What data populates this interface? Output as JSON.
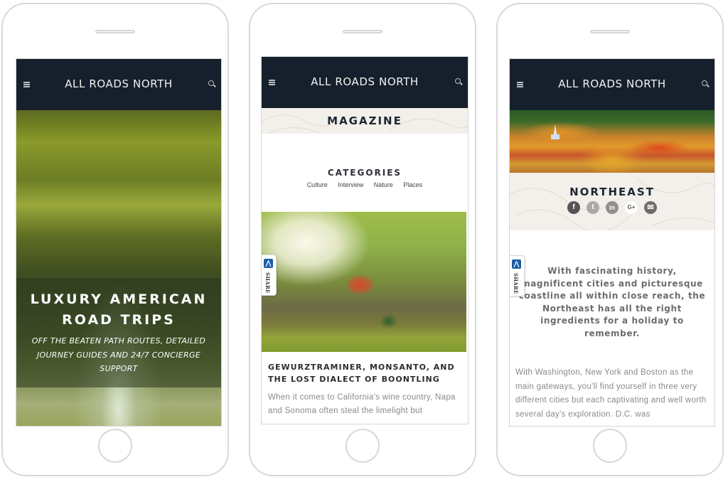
{
  "site": {
    "brand": "ALL ROADS NORTH"
  },
  "phones": [
    {
      "screen": "home",
      "hero": {
        "title_line1": "LUXURY AMERICAN",
        "title_line2": "ROAD TRIPS",
        "subtitle": "OFF THE BEATEN PATH ROUTES, DETAILED JOURNEY GUIDES AND 24/7 CONCIERGE SUPPORT",
        "image": "oak-tree-avenue-photo"
      }
    },
    {
      "screen": "magazine",
      "section_title": "MAGAZINE",
      "categories": {
        "title": "CATEGORIES",
        "items": [
          "Culture",
          "Interview",
          "Nature",
          "Places"
        ]
      },
      "share_label": "SHARE",
      "article": {
        "image": "vineyard-harvest-photo",
        "title": "GEWURZTRAMINER, MONSANTO, AND THE LOST DIALECT OF BOONTLING",
        "excerpt": "When it comes to California's wine country, Napa and Sonoma often steal the limelight but"
      }
    },
    {
      "screen": "region",
      "image": "autumn-village-photo",
      "section_title": "NORTHEAST",
      "share_label": "SHARE",
      "social": [
        {
          "name": "facebook",
          "glyph": "f",
          "color": "#555555"
        },
        {
          "name": "twitter",
          "glyph": "t",
          "color": "#a9a9a9"
        },
        {
          "name": "linkedin",
          "glyph": "in",
          "color": "#8f8f8f"
        },
        {
          "name": "google-plus",
          "glyph": "G+",
          "color": "#ffffff"
        },
        {
          "name": "email",
          "glyph": "✉",
          "color": "#6d6d6d"
        }
      ],
      "intro": "With fascinating history, magnificent cities and picturesque coastline all within close reach, the Northeast has all the right ingredients for a holiday to remember.",
      "body": "With Washington, New York and Boston as the main gateways, you'll find yourself in three very different cities but each captivating and well worth several day's exploration. D.C. was"
    }
  ],
  "colors": {
    "header_bg": "#16202c",
    "band_bg": "#f3efea",
    "title_dark": "#1c2733",
    "share_blue": "#1d5fa6"
  }
}
